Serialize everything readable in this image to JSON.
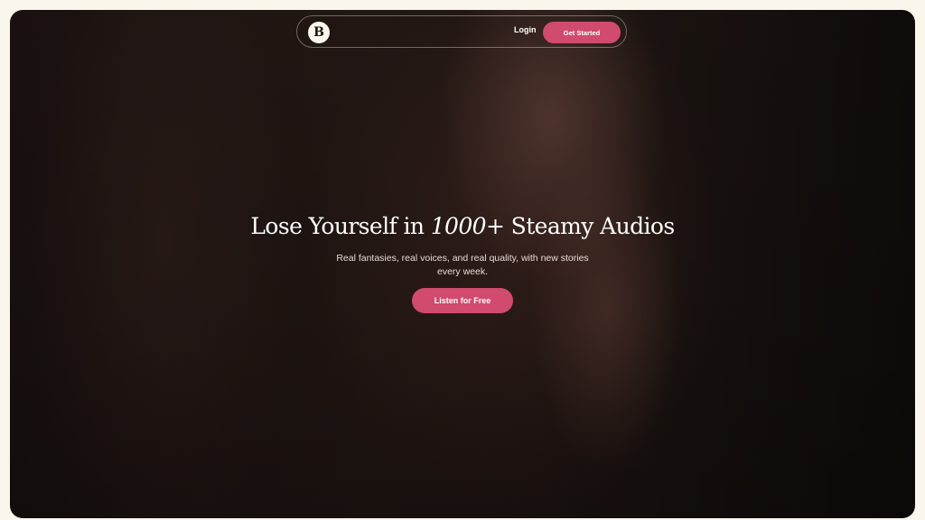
{
  "nav": {
    "logo_letter": "B",
    "login_label": "Login",
    "get_started_label": "Get Started"
  },
  "hero": {
    "headline_pre": "Lose Yourself in ",
    "headline_number": "1000+",
    "headline_post": " Steamy Audios",
    "subtitle": "Real fantasies, real voices, and real quality, with new stories every week.",
    "cta_label": "Listen for Free"
  },
  "colors": {
    "accent": "#d04b6e",
    "page_bg": "#fbf6ec",
    "hero_dark": "#1a1210"
  }
}
